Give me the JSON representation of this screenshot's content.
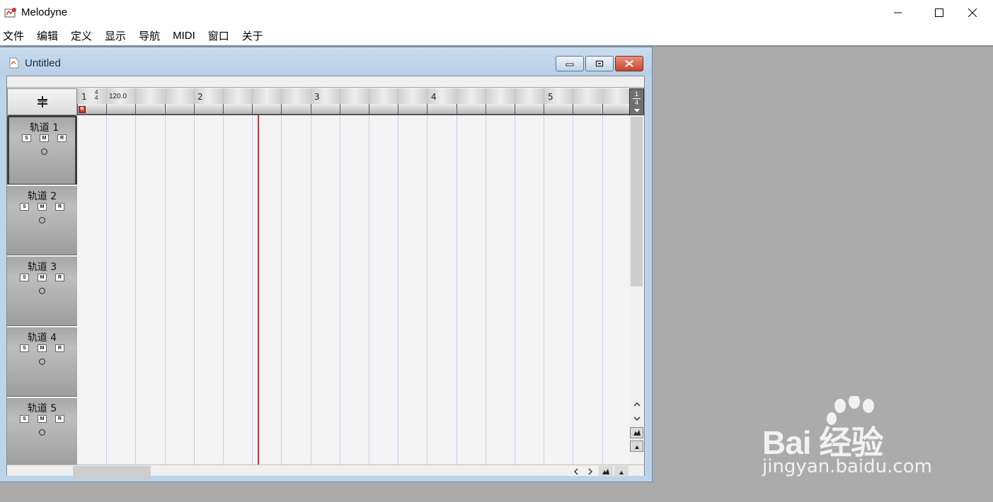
{
  "app": {
    "title": "Melodyne"
  },
  "menu": [
    "文件",
    "编辑",
    "定义",
    "显示",
    "导航",
    "MIDI",
    "窗口",
    "关于"
  ],
  "document": {
    "title": "Untitled"
  },
  "ruler": {
    "bars": [
      "1",
      "2",
      "3",
      "4",
      "5"
    ],
    "time_signature_num": "4",
    "time_signature_den": "4",
    "tempo": "120.0",
    "record_flag": "R",
    "zoom_num": "1",
    "zoom_den": "4"
  },
  "tracks": [
    {
      "name": "轨道 1",
      "solo": "S",
      "mute": "M",
      "record": "R",
      "selected": true
    },
    {
      "name": "轨道 2",
      "solo": "S",
      "mute": "M",
      "record": "R",
      "selected": false
    },
    {
      "name": "轨道 3",
      "solo": "S",
      "mute": "M",
      "record": "R",
      "selected": false
    },
    {
      "name": "轨道 4",
      "solo": "S",
      "mute": "M",
      "record": "R",
      "selected": false
    },
    {
      "name": "轨道 5",
      "solo": "S",
      "mute": "M",
      "record": "R",
      "selected": false
    }
  ],
  "watermark": {
    "logo_text": "Bai 经验",
    "url": "jingyan.baidu.com"
  }
}
